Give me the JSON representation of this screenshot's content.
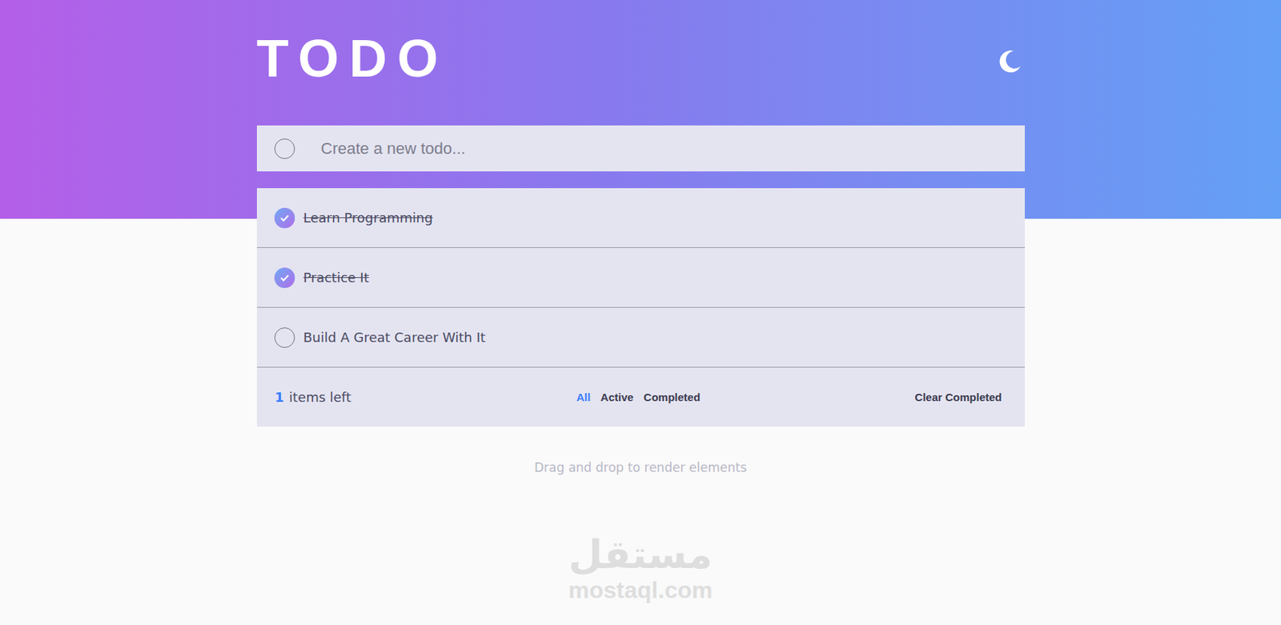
{
  "app": {
    "title": "TODO"
  },
  "new_todo": {
    "placeholder": "Create a new todo..."
  },
  "todos": [
    {
      "text": "Learn Programming",
      "completed": true
    },
    {
      "text": "Practice It",
      "completed": true
    },
    {
      "text": "Build A Great Career With It",
      "completed": false
    }
  ],
  "footer": {
    "count": "1",
    "count_label": "items left",
    "filters": [
      {
        "label": "All",
        "selected": true
      },
      {
        "label": "Active",
        "selected": false
      },
      {
        "label": "Completed",
        "selected": false
      }
    ],
    "clear": "Clear Completed"
  },
  "hint": "Drag and drop to render elements",
  "watermark": {
    "arabic": "مستقل",
    "latin": "mostaql.com"
  }
}
